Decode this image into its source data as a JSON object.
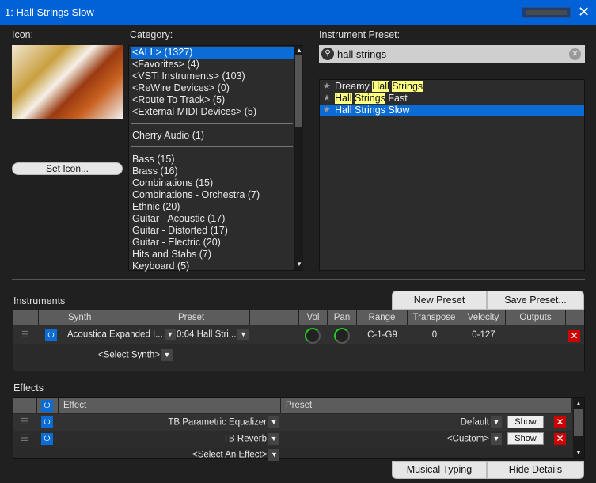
{
  "window": {
    "title": "1: Hall Strings Slow",
    "close_icon": "close-icon"
  },
  "icon_panel": {
    "label": "Icon:",
    "set_icon_label": "Set Icon..."
  },
  "category": {
    "label": "Category:",
    "items": [
      "<ALL> (1327)",
      "<Favorites> (4)",
      "<VSTi Instruments> (103)",
      "<ReWire Devices> (0)",
      "<Route To Track> (5)",
      "<External MIDI Devices> (5)",
      "Cherry Audio (1)",
      "Bass (15)",
      "Brass (16)",
      "Combinations (15)",
      "Combinations - Orchestra (7)",
      "Ethnic (20)",
      "Guitar - Acoustic (17)",
      "Guitar - Distorted (17)",
      "Guitar - Electric (20)",
      "Hits and Stabs (7)",
      "Keyboard (5)"
    ],
    "selected": "<ALL> (1327)"
  },
  "preset": {
    "label": "Instrument Preset:",
    "search_value": "hall strings",
    "results": [
      {
        "parts": [
          {
            "t": "Dreamy ",
            "h": false
          },
          {
            "t": "Hall",
            "h": true
          },
          {
            "t": " ",
            "h": false
          },
          {
            "t": "Strings",
            "h": true
          }
        ]
      },
      {
        "parts": [
          {
            "t": "Hall",
            "h": true
          },
          {
            "t": " ",
            "h": false
          },
          {
            "t": "Strings",
            "h": true
          },
          {
            "t": " Fast",
            "h": false
          }
        ]
      },
      {
        "parts": [
          {
            "t": "Hall Strings Slow",
            "h": false
          }
        ],
        "selected": true
      }
    ]
  },
  "instruments": {
    "label": "Instruments",
    "new_preset": "New Preset",
    "save_preset": "Save Preset...",
    "columns": [
      "Synth",
      "Preset",
      "Vol",
      "Pan",
      "Range",
      "Transpose",
      "Velocity",
      "Outputs"
    ],
    "row": {
      "synth": "Acoustica Expanded I...",
      "preset": "0:64 Hall Stri...",
      "range": "C-1-G9",
      "transpose": "0",
      "velocity": "0-127"
    },
    "select_synth": "<Select Synth>"
  },
  "effects": {
    "label": "Effects",
    "columns": [
      "Effect",
      "Preset"
    ],
    "rows": [
      {
        "effect": "TB Parametric Equalizer",
        "preset": "Default",
        "show": "Show"
      },
      {
        "effect": "TB Reverb",
        "preset": "<Custom>",
        "show": "Show"
      }
    ],
    "select_effect": "<Select An Effect>"
  },
  "footer": {
    "musical_typing": "Musical Typing",
    "hide_details": "Hide Details"
  },
  "colors": {
    "accent": "#0a6cd4",
    "highlight": "#ffff80",
    "delete": "#cc0000"
  }
}
